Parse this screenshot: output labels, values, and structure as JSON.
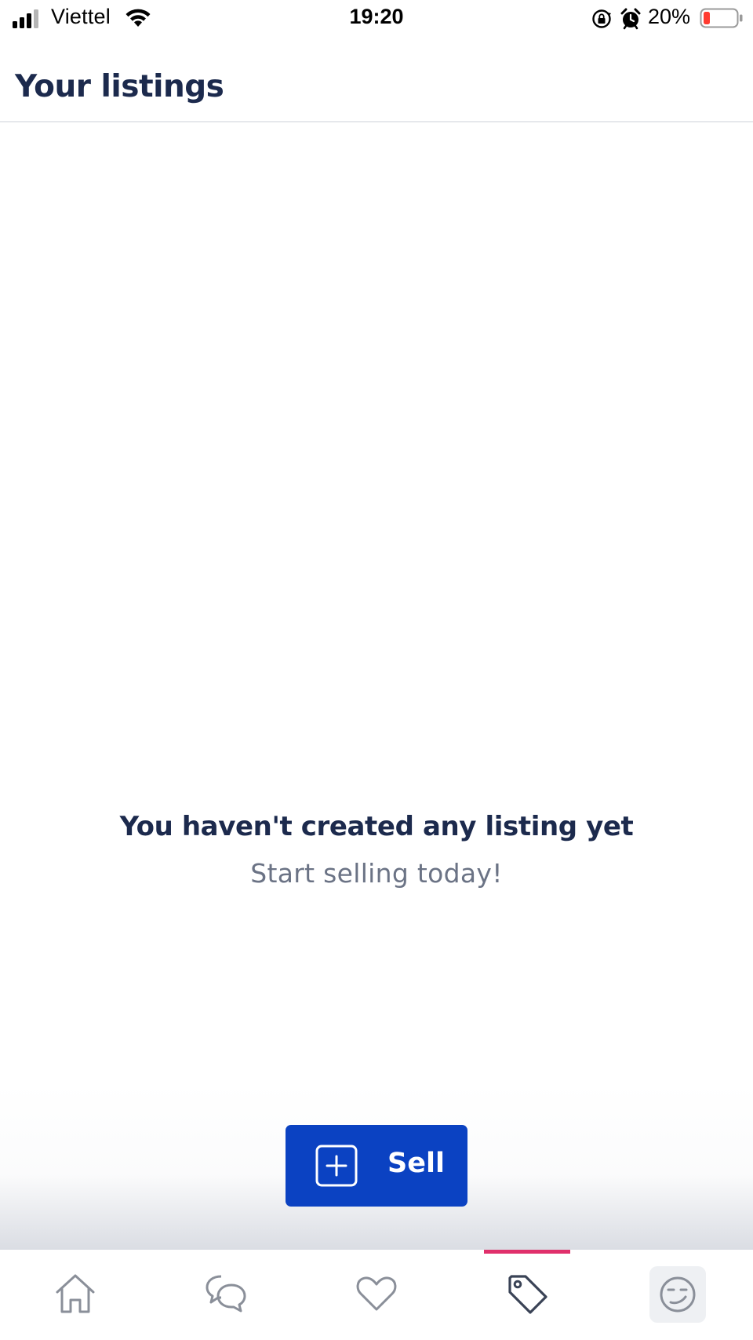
{
  "status_bar": {
    "carrier": "Viettel",
    "time": "19:20",
    "battery_percent": "20%",
    "battery_level": 0.2,
    "icons": [
      "signal-icon",
      "wifi-icon",
      "rotation-lock-icon",
      "alarm-icon",
      "battery-icon"
    ]
  },
  "header": {
    "title": "Your listings"
  },
  "empty_state": {
    "title": "You haven't created any listing yet",
    "subtitle": "Start selling today!"
  },
  "sell_button": {
    "label": "Sell",
    "icon": "plus-square-icon",
    "color": "#0b42c2"
  },
  "bottom_nav": {
    "items": [
      {
        "icon": "home-icon",
        "active": false
      },
      {
        "icon": "chat-icon",
        "active": false
      },
      {
        "icon": "heart-icon",
        "active": false
      },
      {
        "icon": "tag-icon",
        "active": true
      },
      {
        "icon": "profile-face-icon",
        "active": false
      }
    ],
    "indicator_color": "#e0306b"
  },
  "colors": {
    "title": "#1c2a4d",
    "subtitle": "#6b7385",
    "nav_icon": "#8a8f99",
    "nav_icon_active": "#3a4356",
    "battery_low": "#ff3b30"
  }
}
